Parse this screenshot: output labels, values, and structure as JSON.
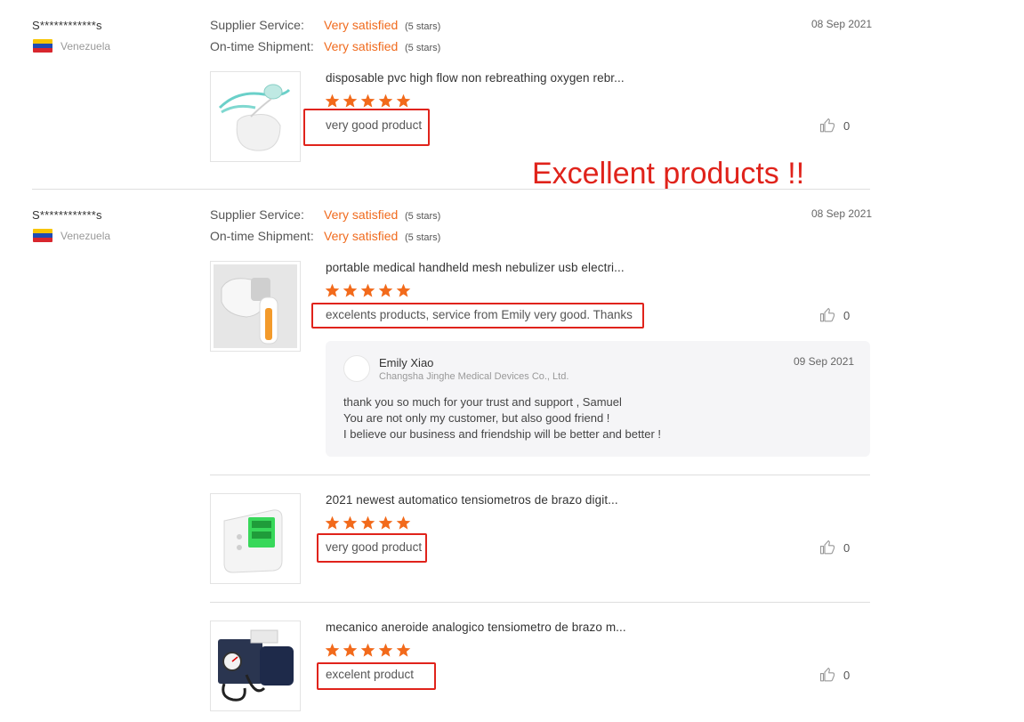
{
  "reviews": [
    {
      "user": "S************s",
      "country": "Venezuela",
      "date": "08 Sep 2021",
      "supplier_service_label": "Supplier Service:",
      "supplier_service_value": "Very satisfied",
      "supplier_service_stars": "(5 stars)",
      "shipment_label": "On-time Shipment:",
      "shipment_value": "Very satisfied",
      "shipment_stars": "(5 stars)",
      "products": [
        {
          "title": "disposable pvc high flow non rebreathing oxygen rebr...",
          "rating": 5,
          "text": "very good product",
          "likes": "0"
        }
      ]
    },
    {
      "user": "S************s",
      "country": "Venezuela",
      "date": "08 Sep 2021",
      "supplier_service_label": "Supplier Service:",
      "supplier_service_value": "Very satisfied",
      "supplier_service_stars": "(5 stars)",
      "shipment_label": "On-time Shipment:",
      "shipment_value": "Very satisfied",
      "shipment_stars": "(5 stars)",
      "products": [
        {
          "title": "portable medical handheld mesh nebulizer usb electri...",
          "rating": 5,
          "text": "excelents products, service from Emily very good. Thanks",
          "likes": "0",
          "reply": {
            "name": "Emily Xiao",
            "company": "Changsha Jinghe Medical Devices Co., Ltd.",
            "date": "09 Sep 2021",
            "lines": [
              "thank you so much for your trust and support , Samuel",
              "You are not only my customer, but also good friend !",
              "I believe our business and friendship will be better and better !"
            ]
          }
        },
        {
          "title": "2021 newest automatico tensiometros de brazo digit...",
          "rating": 5,
          "text": "very good product",
          "likes": "0"
        },
        {
          "title": "mecanico aneroide analogico tensiometro de brazo m...",
          "rating": 5,
          "text": "excelent product",
          "likes": "0"
        }
      ]
    }
  ],
  "annotation": "Excellent products !!",
  "colors": {
    "accent_orange": "#f06b1e",
    "star": "#f26a1b",
    "highlight_red": "#e0231b"
  },
  "icons": {
    "like": "thumbs-up-icon",
    "star": "star-icon",
    "flag": "venezuela-flag-icon"
  }
}
